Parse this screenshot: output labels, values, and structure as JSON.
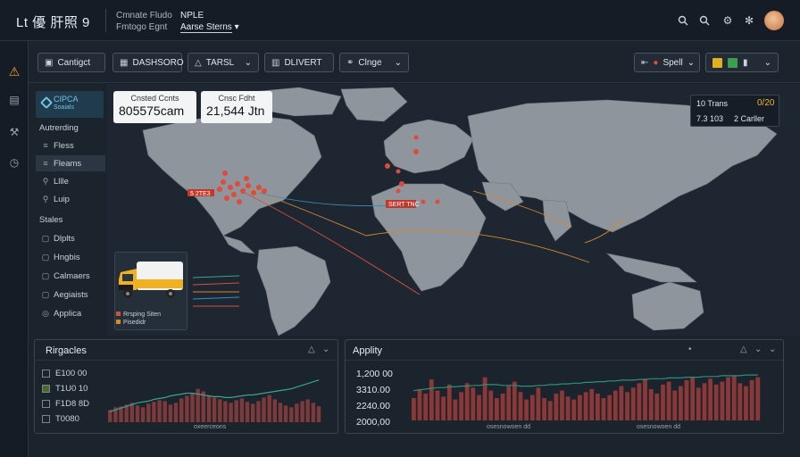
{
  "header": {
    "app_title": "Lt 優 肝照 9",
    "crumb_a_line1": "Cmnate Fludo",
    "crumb_a_line2": "Fmtogo Egnt",
    "crumb_b_line1": "NPLE",
    "crumb_b_line2": "Aarse Sterns",
    "icons": [
      "search-icon",
      "search-icon",
      "settings-icon",
      "gear-icon"
    ]
  },
  "rail": {
    "icons": [
      "warning-icon",
      "document-icon",
      "tools-icon",
      "clock-icon"
    ]
  },
  "toolbar": {
    "contact": "Cantigct",
    "dashboard": "DASHSORO",
    "travel": "TARSL",
    "delivery": "DLIVERT",
    "change": "Clnge",
    "spell": "Spell",
    "flag_icons": [
      "warning-flag-icon",
      "green-flag-icon"
    ]
  },
  "sidebar": {
    "logo_line1": "CIPCA",
    "logo_line2": "Soaials",
    "section1": "Autrerding",
    "items1": [
      {
        "label": "Fless",
        "icon": "list-icon"
      },
      {
        "label": "Fleams",
        "icon": "list-icon"
      },
      {
        "label": "Lllle",
        "icon": "pin-icon"
      },
      {
        "label": "Luip",
        "icon": "pin-icon"
      }
    ],
    "section2": "Stales",
    "items2": [
      {
        "label": "Dlplts",
        "icon": "square-icon"
      },
      {
        "label": "Hngbis",
        "icon": "square-icon"
      },
      {
        "label": "Calmaers",
        "icon": "square-icon"
      },
      {
        "label": "Aegiaists",
        "icon": "square-icon"
      },
      {
        "label": "Applica",
        "icon": "circle-icon"
      }
    ]
  },
  "cards": {
    "left_label": "Cnsted Ccnts",
    "left_value": "805575cam",
    "right_label": "Cnsc Fdht",
    "right_value": "21,544 Jtn"
  },
  "right_card": {
    "r1a": "10 Trans",
    "r1b": "0/20",
    "r2a": "7.3 103",
    "r2b": "2 Carller"
  },
  "map_labels": {
    "na_badge": "5 2TE3",
    "eu_badge": "SERT TNC"
  },
  "truck_legend": [
    "Rrsping Siten",
    "Pisedidr"
  ],
  "panel_left": {
    "title": "Rirgacles",
    "legend": [
      "E100 00",
      "T1U0 10",
      "F1D8 8D",
      "T0080"
    ],
    "x_caption": "oxeerceons"
  },
  "panel_right": {
    "title": "Applity",
    "yticks": [
      "1,200 00",
      "3310.00",
      "2240.00",
      "2000,00"
    ],
    "x_caption": "osesnowoen dd"
  },
  "chart_data": [
    {
      "type": "bar",
      "title": "Rirgacles",
      "values": [
        14,
        17,
        18,
        20,
        22,
        19,
        17,
        21,
        23,
        25,
        24,
        20,
        22,
        27,
        30,
        33,
        38,
        35,
        30,
        28,
        26,
        24,
        22,
        25,
        27,
        23,
        21,
        24,
        28,
        31,
        26,
        22,
        19,
        17,
        21,
        24,
        26,
        22,
        18
      ],
      "line": [
        12,
        14,
        16,
        18,
        20,
        22,
        23,
        24,
        26,
        27,
        28,
        30,
        31,
        32,
        33,
        33,
        32,
        31,
        30,
        29,
        29,
        28,
        28,
        29,
        30,
        31,
        31,
        32,
        33,
        34,
        35,
        36,
        37,
        38,
        40,
        42,
        44,
        46,
        48
      ],
      "colors": {
        "bar": "#7d3a3a",
        "line": "#3aa58f"
      }
    },
    {
      "type": "bar",
      "title": "Applity",
      "values": [
        30,
        42,
        36,
        55,
        40,
        32,
        48,
        28,
        38,
        50,
        44,
        34,
        58,
        40,
        30,
        36,
        46,
        52,
        38,
        28,
        34,
        44,
        30,
        26,
        36,
        40,
        32,
        28,
        34,
        38,
        42,
        36,
        30,
        34,
        40,
        46,
        38,
        44,
        50,
        56,
        42,
        36,
        48,
        52,
        40,
        46,
        54,
        58,
        44,
        50,
        56,
        48,
        52,
        58,
        60,
        50,
        46,
        54,
        58
      ],
      "line": [
        40,
        41,
        42,
        43,
        44,
        44,
        45,
        45,
        46,
        46,
        47,
        47,
        48,
        48,
        48,
        47,
        47,
        47,
        46,
        46,
        46,
        47,
        47,
        48,
        48,
        49,
        49,
        50,
        50,
        51,
        51,
        52,
        52,
        53,
        53,
        54,
        54,
        54,
        55,
        55,
        56,
        56,
        56,
        57,
        57,
        57,
        58,
        58,
        58,
        59,
        59,
        59,
        60,
        60,
        60,
        60,
        61,
        61,
        61
      ],
      "colors": {
        "bar": "#8a3838",
        "line": "#2f8f7a"
      }
    }
  ]
}
